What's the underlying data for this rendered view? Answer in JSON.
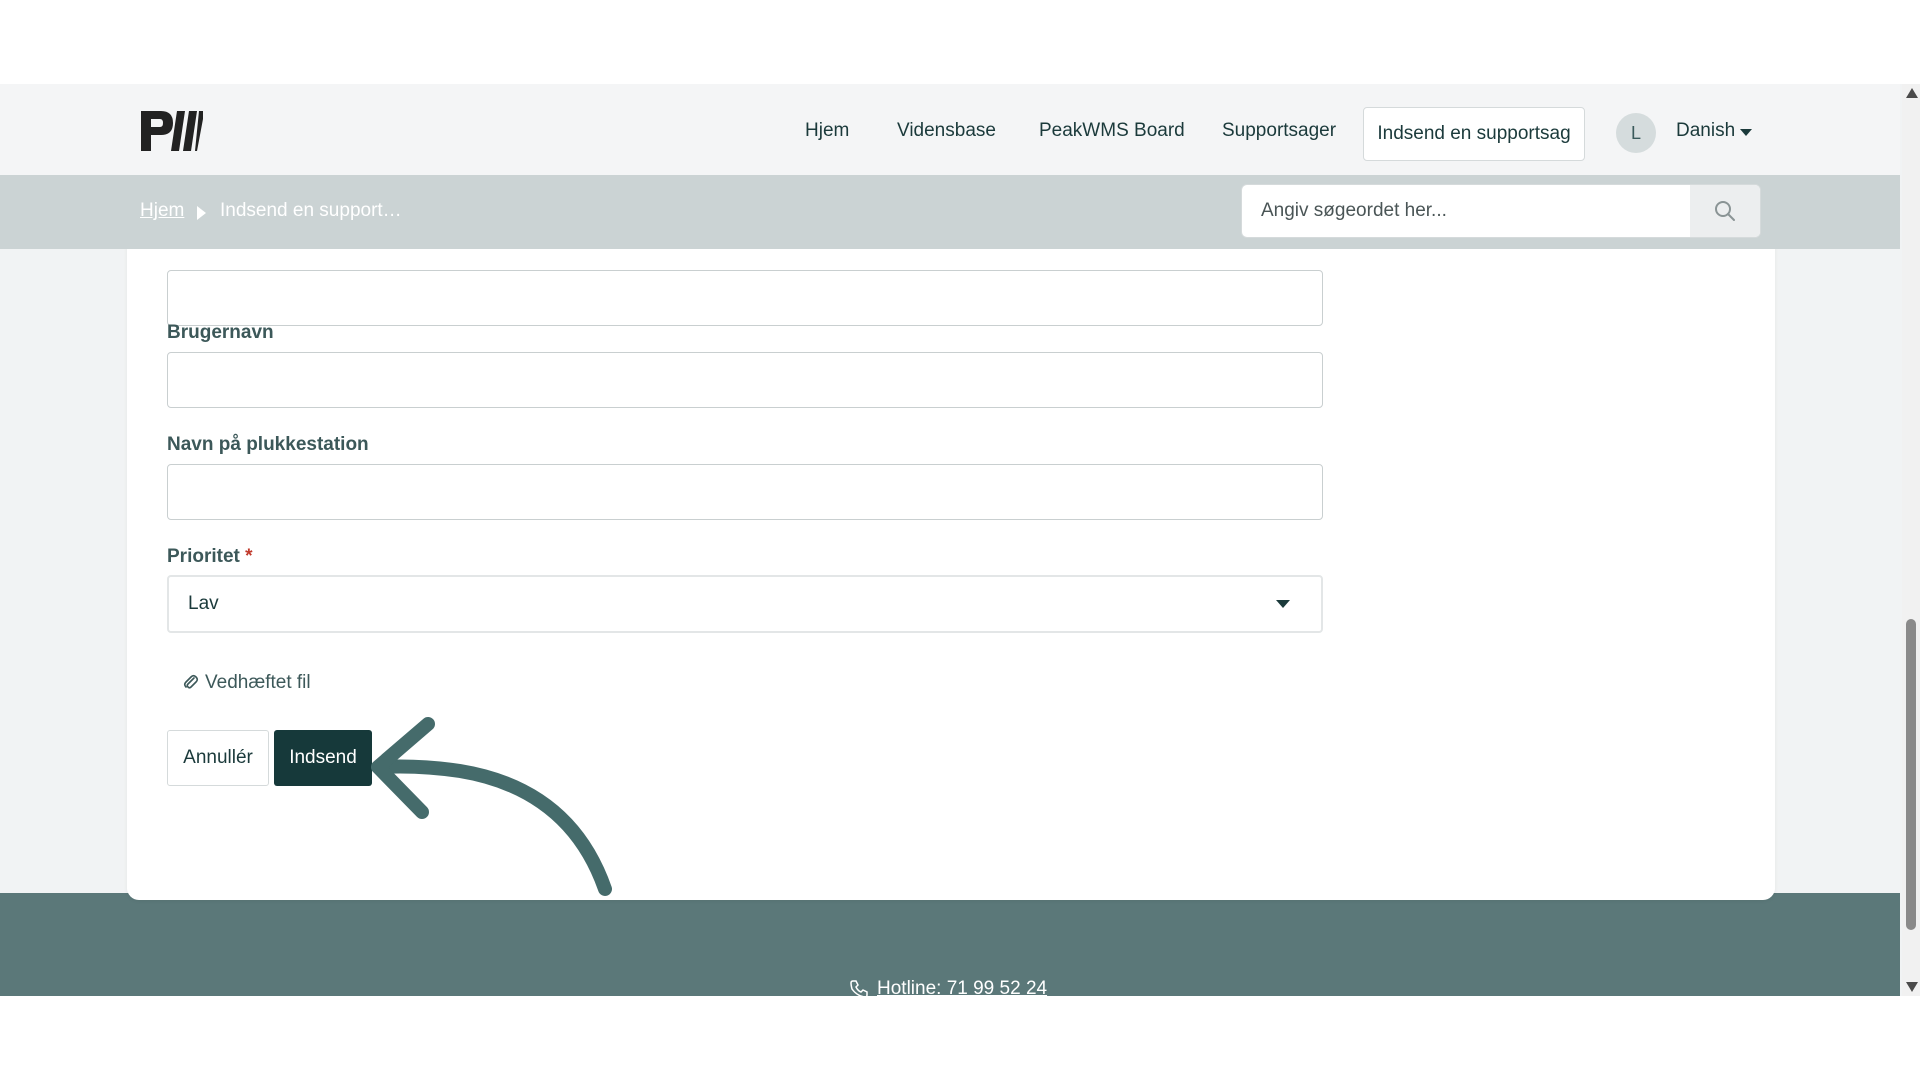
{
  "nav": {
    "logo_alt": "PW",
    "links": [
      "Hjem",
      "Vidensbase",
      "PeakWMS Board",
      "Supportsager"
    ],
    "cta_label": "Indsend en supportsag",
    "avatar_initial": "L",
    "language": "Danish"
  },
  "breadcrumb": {
    "home": "Hjem",
    "current": "Indsend en support…"
  },
  "search": {
    "placeholder": "Angiv søgeordet her..."
  },
  "form": {
    "username_label": "Brugernavn",
    "username_value": "",
    "station_label": "Navn på plukkestation",
    "station_value": "",
    "priority_label": "Prioritet",
    "required_mark": "*",
    "priority_value": "Lav",
    "attachment_label": "Vedhæftet fil",
    "cancel_label": "Annullér",
    "submit_label": "Indsend"
  },
  "footer": {
    "hotline": "Hotline: 71 99 52 24"
  },
  "colors": {
    "primary": "#16393a",
    "footer_bg": "#5b7879",
    "crumb_bg": "#cbd3d4",
    "annotation_arrow": "#456b6b"
  }
}
